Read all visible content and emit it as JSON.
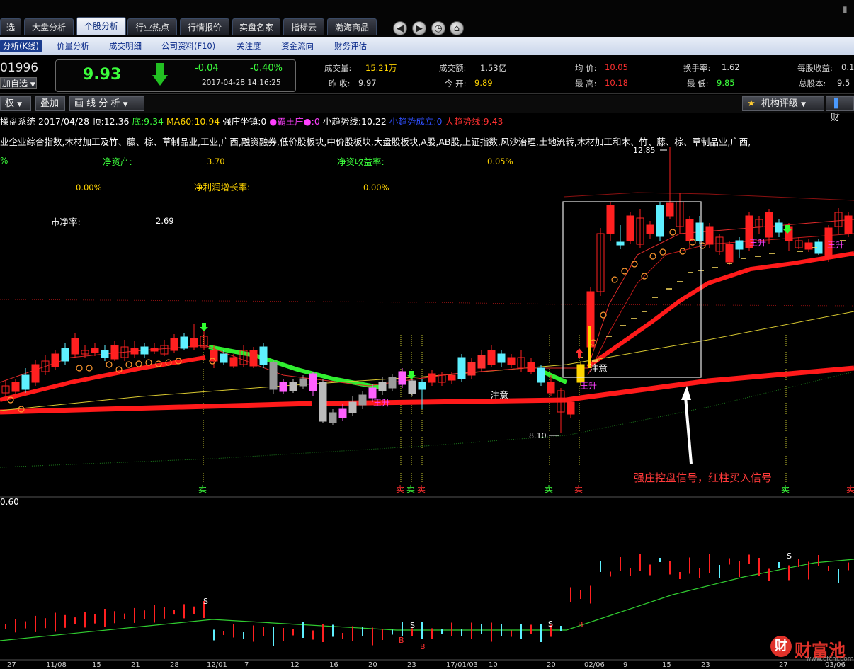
{
  "tabs": [
    {
      "label": "选",
      "active": false
    },
    {
      "label": "大盘分析",
      "active": false
    },
    {
      "label": "个股分析",
      "active": true
    },
    {
      "label": "行业热点",
      "active": false
    },
    {
      "label": "行情报价",
      "active": false
    },
    {
      "label": "实盘名家",
      "active": false
    },
    {
      "label": "指标云",
      "active": false
    },
    {
      "label": "渤海商品",
      "active": false
    }
  ],
  "nav_icons": [
    "back-icon",
    "forward-icon",
    "clock-icon",
    "home-icon"
  ],
  "subtabs": [
    {
      "label": "分析(K线)",
      "active": true
    },
    {
      "label": "价量分析",
      "active": false
    },
    {
      "label": "成交明细",
      "active": false
    },
    {
      "label": "公司资料(F10)",
      "active": false
    },
    {
      "label": "关注度",
      "active": false
    },
    {
      "label": "资金流向",
      "active": false
    },
    {
      "label": "财务评估",
      "active": false
    }
  ],
  "quote": {
    "code": "01996",
    "add_watch": "加自选",
    "price": "9.93",
    "change": "-0.04",
    "change_pct": "-0.40%",
    "datetime": "2017-04-28 14:16:25",
    "fields": [
      {
        "label": "成交量:",
        "value": "15.21万",
        "color": "#ffd400"
      },
      {
        "label": "成交额:",
        "value": "1.53亿",
        "color": "#d8d8d8"
      },
      {
        "label": "均  价:",
        "value": "10.05",
        "color": "#ff3030"
      },
      {
        "label": "换手率:",
        "value": "1.62",
        "color": "#d8d8d8"
      },
      {
        "label": "每股收益:",
        "value": "0.1",
        "color": "#d8d8d8"
      },
      {
        "label": "昨  收:",
        "value": "9.97",
        "color": "#d8d8d8"
      },
      {
        "label": "今  开:",
        "value": "9.89",
        "color": "#ffd400"
      },
      {
        "label": "最  高:",
        "value": "10.18",
        "color": "#ff3030"
      },
      {
        "label": "最  低:",
        "value": "9.85",
        "color": "#3cff3c"
      },
      {
        "label": "总股本:",
        "value": "9.5",
        "color": "#d8d8d8"
      }
    ]
  },
  "toolbar": {
    "left_btn": "权",
    "overlay_btn": "叠加",
    "draw_btn": "画 线 分 析",
    "rating_btn": "机构评级",
    "right_btn": "财"
  },
  "indicator_line": [
    {
      "text": "操盘系统 2017/04/28 顶:12.36 ",
      "color": "#ffffff"
    },
    {
      "text": "底:9.34 ",
      "color": "#3cff3c"
    },
    {
      "text": "MA60:10.94 ",
      "color": "#ffd400"
    },
    {
      "text": "强庄坐镇:0 ",
      "color": "#ffffff"
    },
    {
      "text": "●霸王庄●:0 ",
      "color": "#ff40ff"
    },
    {
      "text": "小趋势线:10.22 ",
      "color": "#ffffff"
    },
    {
      "text": "小趋势成立:0 ",
      "color": "#3050ff"
    },
    {
      "text": "大趋势线:9.43",
      "color": "#ff3030"
    }
  ],
  "sectors": "业企业综合指数,木材加工及竹、藤、棕、草制品业,工业,广西,融资融券,低价股板块,中价股板块,大盘股板块,A股,AB股,上证指数,风沙治理,土地流转,木材加工和木、竹、藤、棕、草制品业,广西,",
  "fin": {
    "pct_left": "%",
    "net_assets_lbl": "净资产:",
    "net_assets": "3.70",
    "roe_lbl": "净资收益率:",
    "roe": "0.05%",
    "left_pct": "0.00%",
    "profit_growth_lbl": "净利润增长率:",
    "profit_growth": "0.00%",
    "pb_lbl": "市净率:",
    "pb": "2.69"
  },
  "annotations": {
    "high_label": "12.85",
    "low_label": "8.10",
    "attention1": "注意",
    "attention2": "注意",
    "wang1": "王升",
    "wang2": "王升",
    "wang3": "王升",
    "wang4": "王升",
    "callout": "强庄控盘信号，红柱买入信号",
    "sell": "卖",
    "sub_value": "0.60",
    "s_mark": "S",
    "b_mark": "B"
  },
  "x_ticks": [
    "27",
    "11/08",
    "15",
    "21",
    "28",
    "12/01",
    "7",
    "12",
    "16",
    "20",
    "23",
    "17/01/03",
    "10",
    "20",
    "02/06",
    "9",
    "15",
    "23",
    "27",
    "03/06"
  ],
  "watermark": "财富池",
  "watermark_url": "www.cfchi.com",
  "chart_data": {
    "type": "candlestick",
    "note_series": [
      "price candles",
      "大趋势线",
      "小趋势线",
      "MA60"
    ],
    "visible_values": {
      "top": 12.85,
      "bottom": 8.1,
      "ma60": 10.94,
      "small_trend": 10.22,
      "big_trend": 9.43
    }
  }
}
